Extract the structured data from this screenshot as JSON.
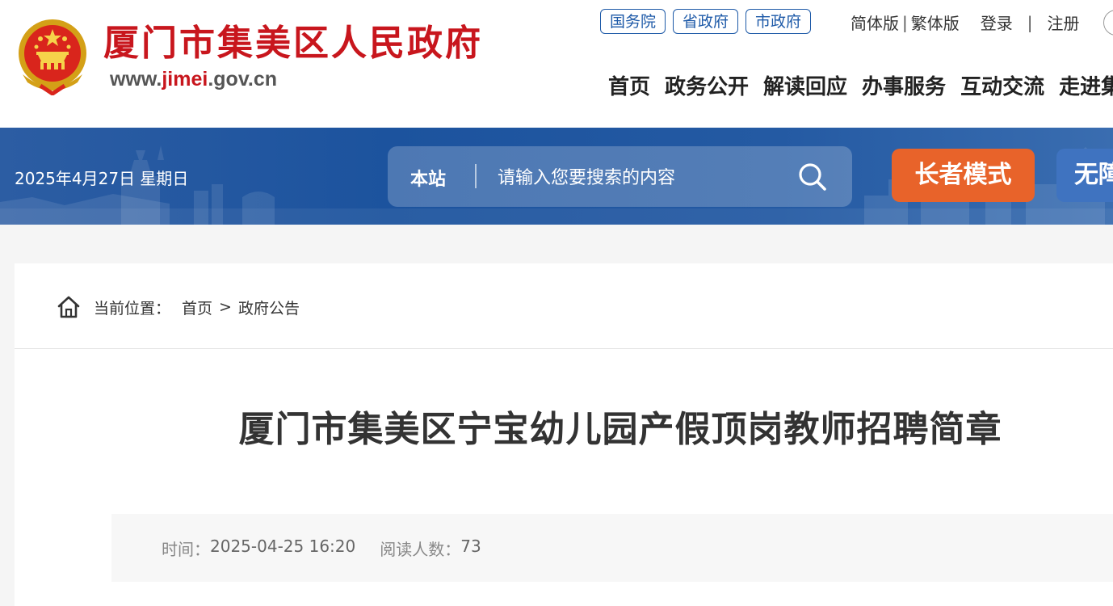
{
  "header": {
    "site_title": "厦门市集美区人民政府",
    "site_url_prefix": "www.",
    "site_url_accent": "jimei",
    "site_url_suffix": ".gov.cn",
    "gov_links": [
      "国务院",
      "省政府",
      "市政府"
    ],
    "simplified_label": "简体版",
    "lang_separator": "|",
    "traditional_label": "繁体版",
    "login_label": "登录",
    "auth_separator": "|",
    "register_label": "注册",
    "nav": [
      "首页",
      "政务公开",
      "解读回应",
      "办事服务",
      "互动交流",
      "走进集美"
    ]
  },
  "banner": {
    "date": "2025年4月27日 星期日",
    "search_scope": "本站",
    "search_placeholder": "请输入您要搜索的内容",
    "elder_mode_label": "长者模式",
    "accessibility_label": "无障碍"
  },
  "breadcrumb": {
    "label": "当前位置：",
    "items": [
      "首页",
      "政府公告"
    ],
    "separator": ">"
  },
  "article": {
    "title": "厦门市集美区宁宝幼儿园产假顶岗教师招聘简章",
    "time_label": "时间：",
    "time_value": "2025-04-25 16:20",
    "reads_label": "阅读人数：",
    "reads_value": "73"
  },
  "colors": {
    "brand_red": "#c8161d",
    "banner_blue": "#1c539e",
    "link_blue": "#1e5aa8",
    "elder_orange": "#e8632a",
    "access_blue": "#3f73c0"
  },
  "icons": {
    "emblem": "national-emblem-icon",
    "search": "search-icon",
    "home": "home-icon"
  }
}
